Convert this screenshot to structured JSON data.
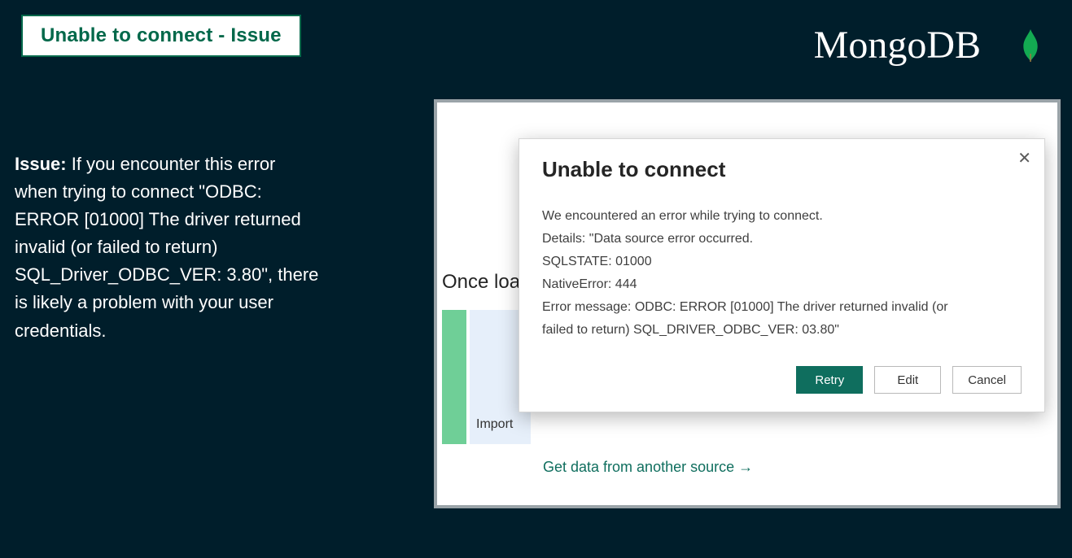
{
  "slide": {
    "title": "Unable to connect - Issue",
    "issue_label": "Issue:",
    "issue_body": " If you encounter this error when trying to connect \"ODBC: ERROR [01000] The driver returned invalid (or failed to return) SQL_Driver_ODBC_VER: 3.80\", there is likely a problem with your user credentials."
  },
  "brand": {
    "name": "MongoDB",
    "leaf_color": "#13aa52"
  },
  "background_window": {
    "partial_text": "Once loa",
    "import_label": "Import",
    "other_source_link": "Get data from another source →"
  },
  "dialog": {
    "title": "Unable to connect",
    "lines": {
      "intro": "We encountered an error while trying to connect.",
      "details": "Details: \"Data source error occurred.",
      "sqlstate": "SQLSTATE: 01000",
      "native": "NativeError: 444",
      "err1": "Error message: ODBC: ERROR [01000] The driver returned invalid (or",
      "err2": "failed to return) SQL_DRIVER_ODBC_VER: 03.80\""
    },
    "buttons": {
      "retry": "Retry",
      "edit": "Edit",
      "cancel": "Cancel"
    }
  }
}
